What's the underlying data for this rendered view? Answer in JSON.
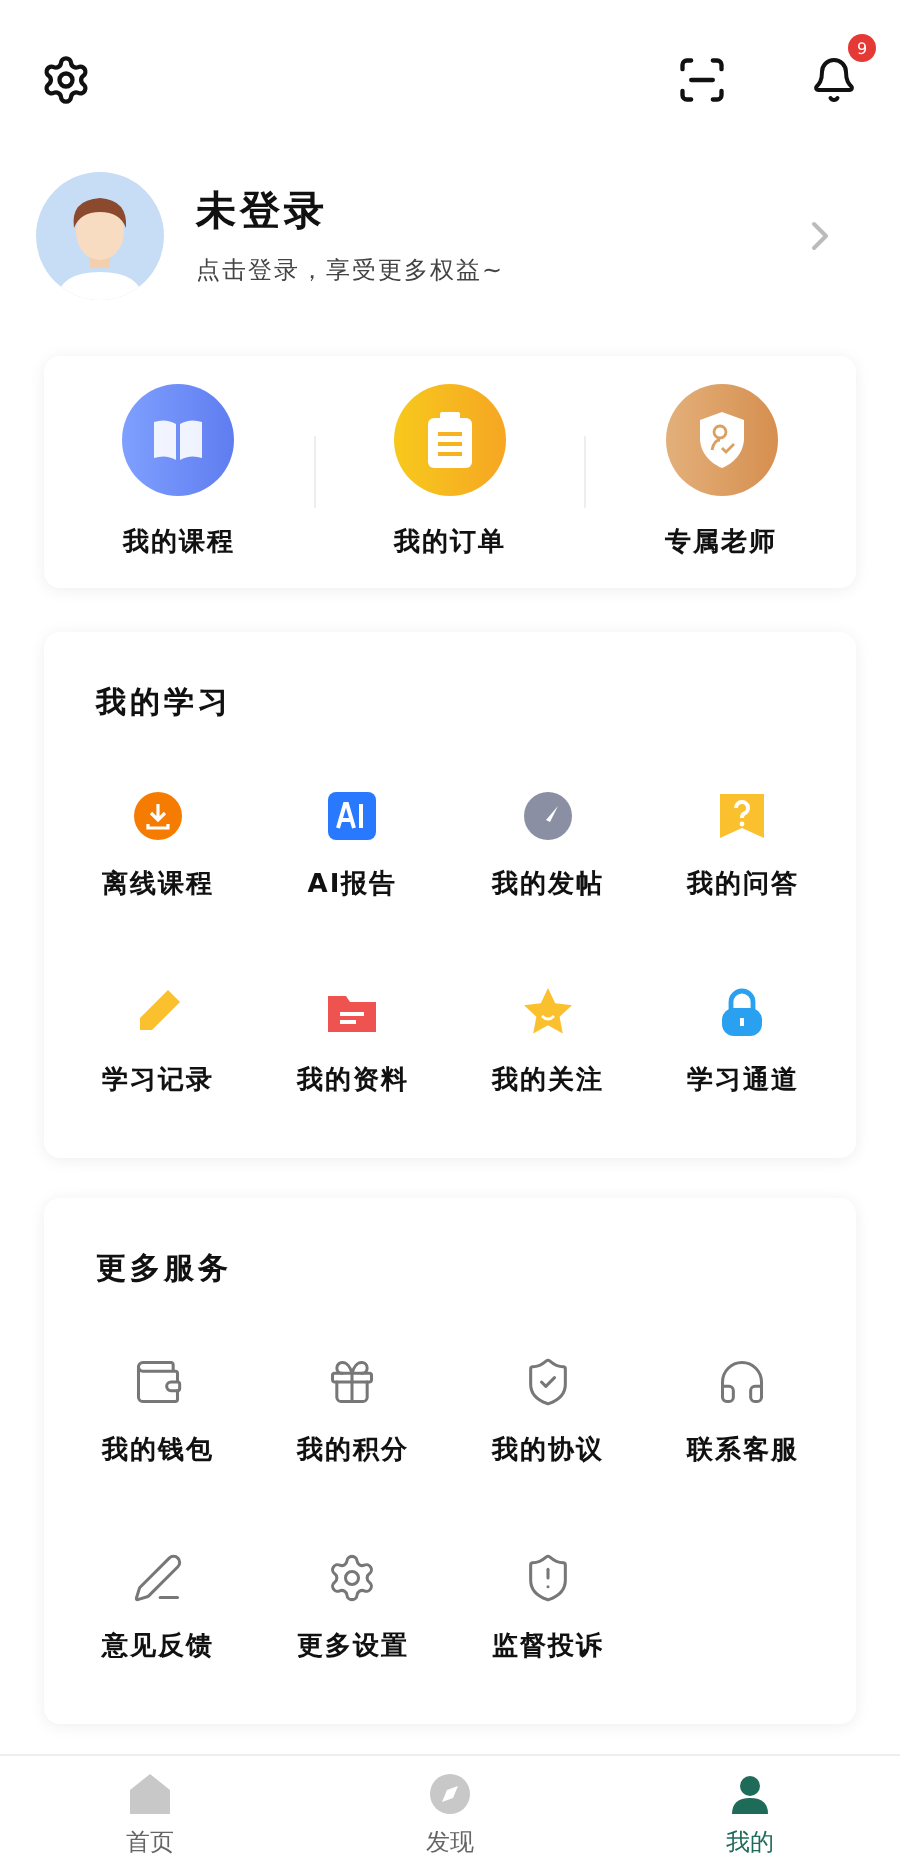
{
  "header": {
    "notification_badge": "9"
  },
  "profile": {
    "name": "未登录",
    "subtitle": "点击登录，享受更多权益~"
  },
  "shortcuts": [
    {
      "label": "我的课程"
    },
    {
      "label": "我的订单"
    },
    {
      "label": "专属老师"
    }
  ],
  "my_learning": {
    "title": "我的学习",
    "items": [
      {
        "label": "离线课程"
      },
      {
        "label": "AI报告"
      },
      {
        "label": "我的发帖"
      },
      {
        "label": "我的问答"
      },
      {
        "label": "学习记录"
      },
      {
        "label": "我的资料"
      },
      {
        "label": "我的关注"
      },
      {
        "label": "学习通道"
      }
    ]
  },
  "more_services": {
    "title": "更多服务",
    "items": [
      {
        "label": "我的钱包"
      },
      {
        "label": "我的积分"
      },
      {
        "label": "我的协议"
      },
      {
        "label": "联系客服"
      },
      {
        "label": "意见反馈"
      },
      {
        "label": "更多设置"
      },
      {
        "label": "监督投诉"
      }
    ]
  },
  "tab_bar": [
    {
      "label": "首页",
      "selected": false
    },
    {
      "label": "发现",
      "selected": false
    },
    {
      "label": "我的",
      "selected": true
    }
  ]
}
